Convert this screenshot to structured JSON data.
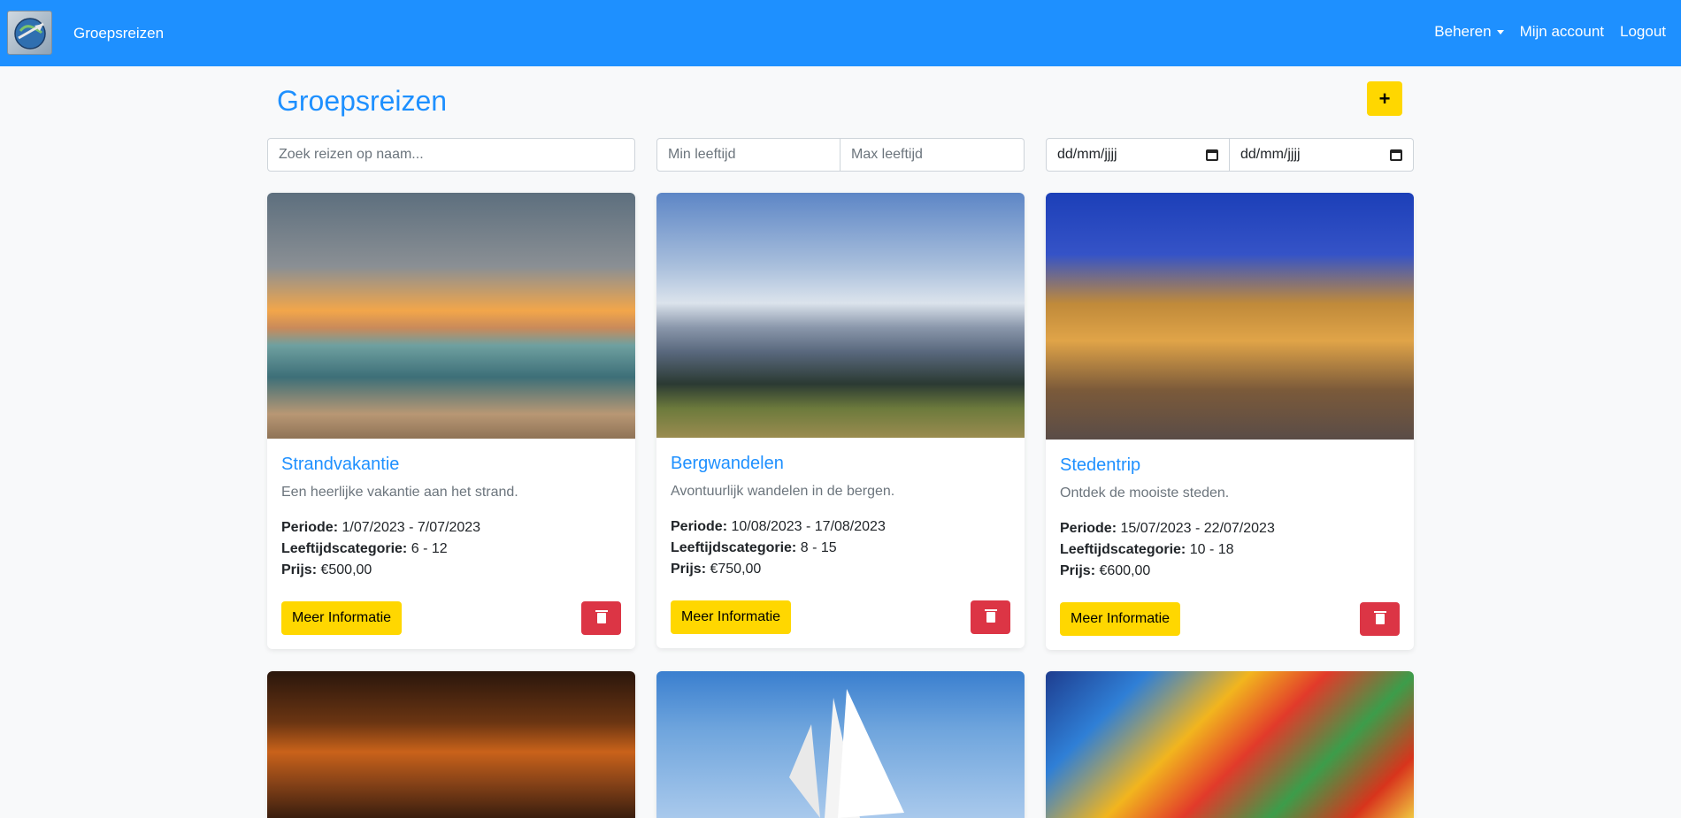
{
  "nav": {
    "brand": "Groepsreizen",
    "links": {
      "beheren": "Beheren",
      "account": "Mijn account",
      "logout": "Logout"
    }
  },
  "page": {
    "title": "Groepsreizen",
    "add_label": "+"
  },
  "filters": {
    "search_placeholder": "Zoek reizen op naam...",
    "min_age_placeholder": "Min leeftijd",
    "max_age_placeholder": "Max leeftijd",
    "date_from": "dd/mm/jjjj",
    "date_to": "dd/mm/jjjj"
  },
  "labels": {
    "periode": "Periode:",
    "leeftijd": "Leeftijdscategorie:",
    "prijs": "Prijs:",
    "info_button": "Meer Informatie"
  },
  "trips": [
    {
      "title": "Strandvakantie",
      "description": "Een heerlijke vakantie aan het strand.",
      "periode": "1/07/2023 - 7/07/2023",
      "leeftijd": "6 - 12",
      "prijs": "€500,00"
    },
    {
      "title": "Bergwandelen",
      "description": "Avontuurlijk wandelen in de bergen.",
      "periode": "10/08/2023 - 17/08/2023",
      "leeftijd": "8 - 15",
      "prijs": "€750,00"
    },
    {
      "title": "Stedentrip",
      "description": "Ontdek de mooiste steden.",
      "periode": "15/07/2023 - 22/07/2023",
      "leeftijd": "10 - 18",
      "prijs": "€600,00"
    }
  ],
  "colors": {
    "brand_blue": "#1e90ff",
    "accent_yellow": "#ffd700",
    "danger_red": "#dc3545"
  }
}
